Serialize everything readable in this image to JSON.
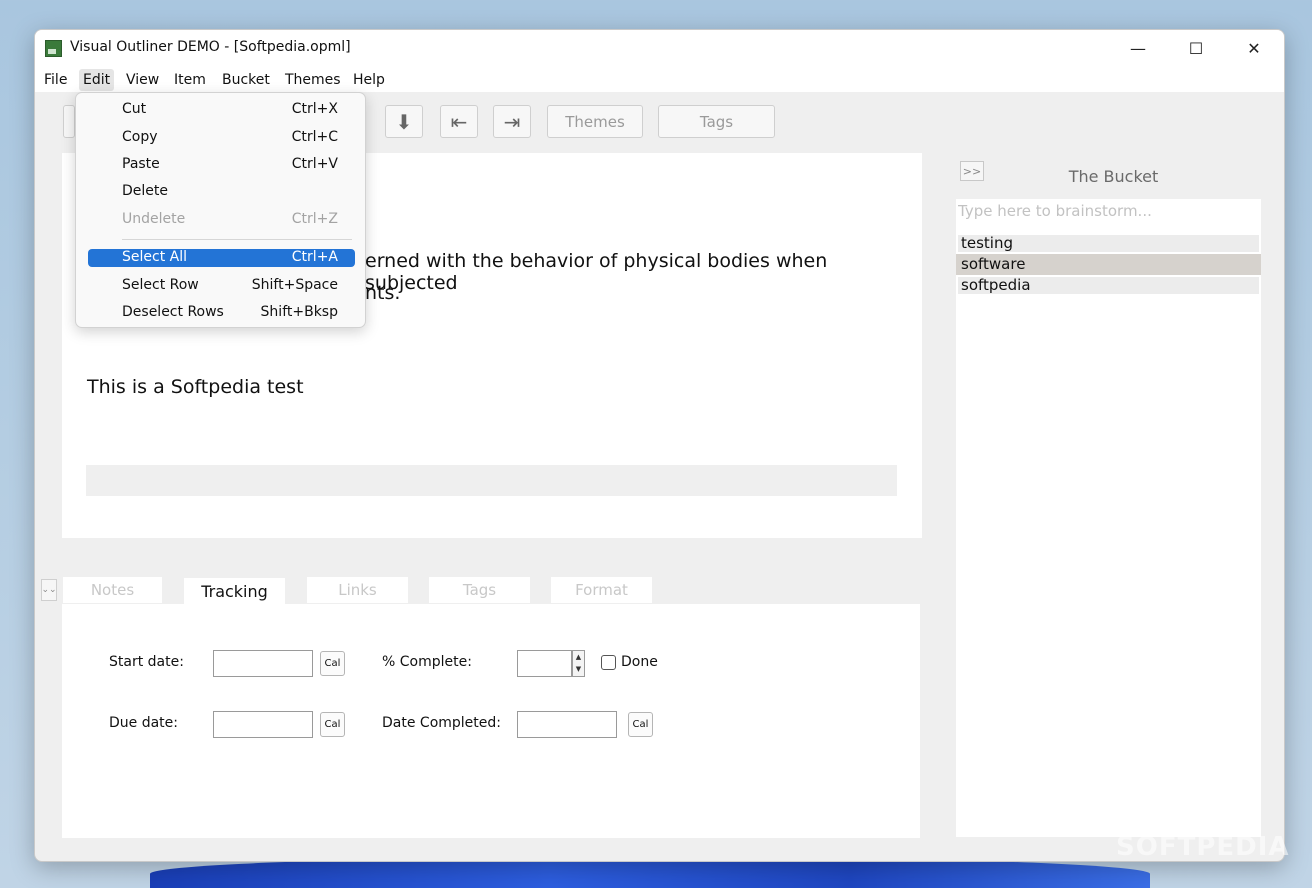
{
  "window": {
    "title": "Visual Outliner DEMO  -  [Softpedia.opml]",
    "minimize_glyph": "—",
    "maximize_glyph": "☐",
    "close_glyph": "✕"
  },
  "menubar": [
    "File",
    "Edit",
    "View",
    "Item",
    "Bucket",
    "Themes",
    "Help"
  ],
  "toolbar": {
    "down_arrow": "⬇",
    "outdent": "⇤",
    "indent": "⇥",
    "themes_label": "Themes",
    "tags_label": "Tags"
  },
  "outline": {
    "line1": "erned with the behavior of physical bodies when subjected",
    "line2": "nts.",
    "line3": "This is a Softpedia test"
  },
  "bucket": {
    "toggle": ">>",
    "title": "The Bucket",
    "placeholder": "Type here to brainstorm...",
    "items": [
      "testing",
      "software",
      "softpedia"
    ]
  },
  "detail_tabs": {
    "collapse_glyph": "⌄⌄",
    "tabs": [
      "Notes",
      "Tracking",
      "Links",
      "Tags",
      "Format"
    ],
    "active": "Tracking"
  },
  "tracking": {
    "start_date_label": "Start date:",
    "due_date_label": "Due date:",
    "percent_label": "% Complete:",
    "date_completed_label": "Date Completed:",
    "done_label": "Done",
    "cal_label": "Cal"
  },
  "edit_menu": [
    {
      "label": "Cut",
      "shortcut": "Ctrl+X"
    },
    {
      "label": "Copy",
      "shortcut": "Ctrl+C"
    },
    {
      "label": "Paste",
      "shortcut": "Ctrl+V"
    },
    {
      "label": "Delete",
      "shortcut": ""
    },
    {
      "label": "Undelete",
      "shortcut": "Ctrl+Z"
    },
    {
      "label": "Select All",
      "shortcut": "Ctrl+A"
    },
    {
      "label": "Select Row",
      "shortcut": "Shift+Space"
    },
    {
      "label": "Deselect Rows",
      "shortcut": "Shift+Bksp"
    }
  ],
  "watermark": "SOFTPEDIA",
  "colors": {
    "highlight": "#2374d6",
    "bucket_selected": "#d6d2cd"
  }
}
